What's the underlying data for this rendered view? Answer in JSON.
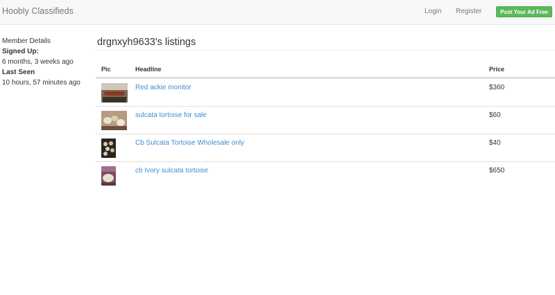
{
  "navbar": {
    "brand": "Hoobly Classifieds",
    "login": "Login",
    "register": "Register",
    "post_button": "Post Your Ad Free"
  },
  "sidebar": {
    "member_details": "Member Details",
    "signed_up_label": "Signed Up:",
    "signed_up_value": "6 months, 3 weeks ago",
    "last_seen_label": "Last Seen",
    "last_seen_value": "10 hours, 57 minutes ago"
  },
  "main": {
    "title": "drgnxyh9633's listings",
    "columns": {
      "pic": "Pic",
      "headline": "Headline",
      "price": "Price"
    },
    "listings": [
      {
        "headline": "Red ackie monitor",
        "price": "$360"
      },
      {
        "headline": "sulcata tortoise for sale",
        "price": "$60"
      },
      {
        "headline": "Cb Sulcata Tortoise Wholesale only",
        "price": "$40"
      },
      {
        "headline": "cb Ivory sulcata tortoise",
        "price": "$650"
      }
    ]
  },
  "colors": {
    "link": "#428bca",
    "post_button": "#5cb85c",
    "navbar_bg": "#f8f8f8"
  }
}
